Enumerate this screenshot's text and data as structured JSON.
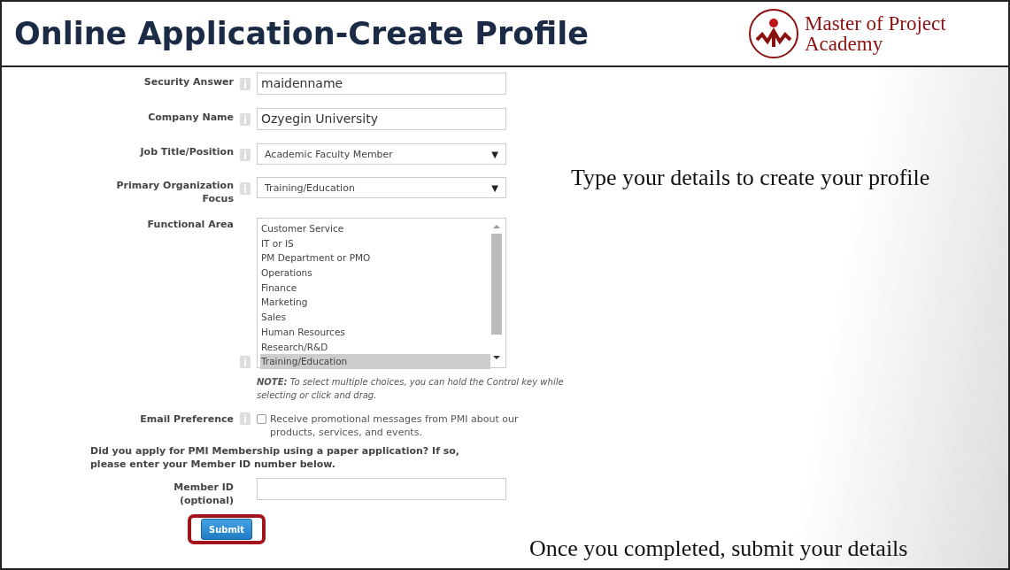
{
  "header": {
    "title": "Online Application-Create Profile",
    "logo_text": "Master of Project Academy"
  },
  "form": {
    "fields": [
      {
        "kind": "text",
        "label": "Security Answer",
        "info": true,
        "value": "maidenname"
      },
      {
        "kind": "text",
        "label": "Company Name",
        "info": true,
        "value": "Ozyegin University"
      },
      {
        "kind": "select",
        "label": "Job Title/Position",
        "info": true,
        "value": "Academic Faculty Member",
        "caret": "▼"
      },
      {
        "kind": "select",
        "label": "Primary Organization Focus",
        "info": true,
        "value": "Training/Education",
        "caret": "▼"
      },
      {
        "kind": "listbox",
        "label": "Functional Area",
        "info": true,
        "options": [
          {
            "label": "Customer Service",
            "selected": false
          },
          {
            "label": "IT or IS",
            "selected": false
          },
          {
            "label": "PM Department or PMO",
            "selected": false
          },
          {
            "label": "Operations",
            "selected": false
          },
          {
            "label": "Finance",
            "selected": false
          },
          {
            "label": "Marketing",
            "selected": false
          },
          {
            "label": "Sales",
            "selected": false
          },
          {
            "label": "Human Resources",
            "selected": false
          },
          {
            "label": "Research/R&D",
            "selected": false
          },
          {
            "label": "Training/Education",
            "selected": true
          }
        ],
        "note": "**NOTE:** To select multiple choices, you can hold the Control key while selecting or click and drag."
      },
      {
        "kind": "checkbox",
        "label": "Email Preference",
        "info": true,
        "checked": false,
        "text": "Receive promotional messages from PMI about our products, services, and events."
      },
      {
        "kind": "question",
        "text": "Did you apply for PMI Membership using a paper application? If so, please enter your Member ID number below."
      },
      {
        "kind": "text",
        "label": "Member ID",
        "sublabel": "(optional)",
        "info": false
      }
    ],
    "submit": {
      "label": "Submit",
      "highlighted": true
    }
  },
  "callouts": [
    "Type your details to create your profile",
    "Once you completed, submit your details"
  ]
}
